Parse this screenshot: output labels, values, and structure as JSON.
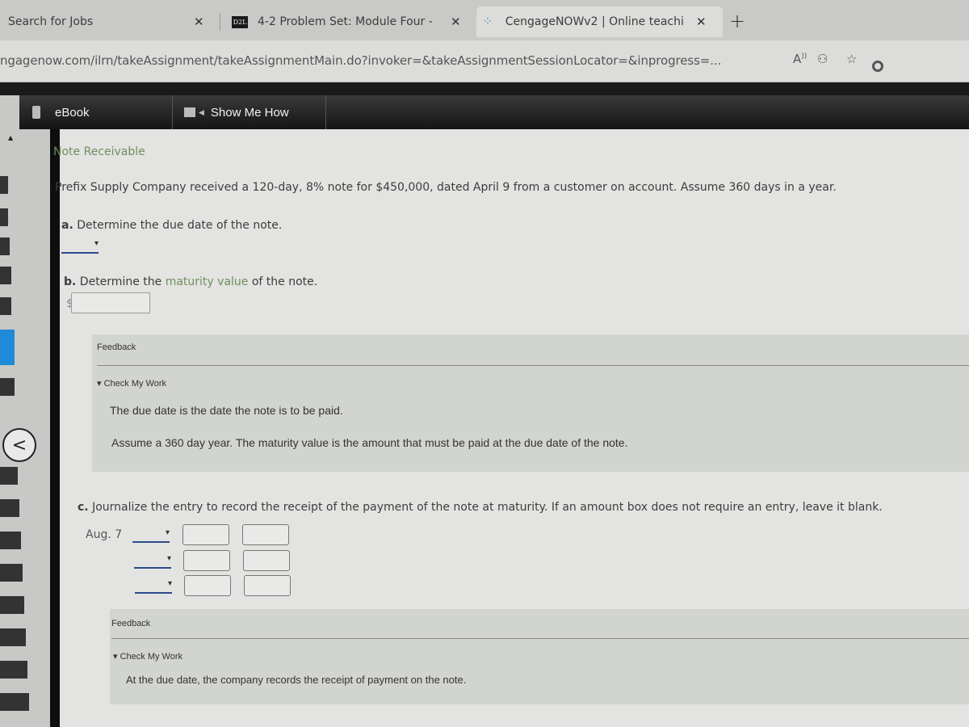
{
  "browser": {
    "tabs": [
      {
        "label": "Search for Jobs",
        "close": "✕"
      },
      {
        "label": "4-2 Problem Set: Module Four -",
        "favicon": "D2L",
        "close": "✕"
      },
      {
        "label": "CengageNOWv2 | Online teachi",
        "favicon": "loading-spinner",
        "close": "✕",
        "active": true
      }
    ],
    "new_tab": "+",
    "url": "ngagenow.com/ilrn/takeAssignment/takeAssignmentMain.do?invoker=&takeAssignmentSessionLocator=&inprogress=...",
    "icons": [
      "read-aloud-icon",
      "profile-icon",
      "add-favorite-icon",
      "extension-icon"
    ]
  },
  "toolbar": {
    "ebook_label": "eBook",
    "show_me_how_label": "Show Me How"
  },
  "problem": {
    "title": "Note Receivable",
    "statement": "Prefix Supply Company received a 120-day, 8% note for $450,000, dated April 9 from a customer on account. Assume 360 days in a year.",
    "part_a": {
      "prefix": "a.",
      "text": "Determine the due date of the note.",
      "due_date_value": ""
    },
    "part_b": {
      "prefix": "b.",
      "text_before": "Determine the",
      "link": "maturity value",
      "text_after": "of the note.",
      "currency": "$",
      "maturity_value": ""
    },
    "feedback_1": {
      "title": "Feedback",
      "check_label": "Check My Work",
      "lines": [
        "The due date is the date the note is to be paid.",
        "Assume a 360 day year. The maturity value is the amount that must be paid at the due date of the note."
      ]
    },
    "part_c": {
      "prefix": "c.",
      "text": "Journalize the entry to record the receipt of the payment of the note at maturity. If an amount box does not require an entry, leave it blank.",
      "date_label": "Aug. 7",
      "rows": [
        {
          "account": "",
          "debit": "",
          "credit": ""
        },
        {
          "account": "",
          "debit": "",
          "credit": ""
        },
        {
          "account": "",
          "debit": "",
          "credit": ""
        }
      ]
    },
    "feedback_2": {
      "title": "Feedback",
      "check_label": "Check My Work",
      "lines": [
        "At the due date, the company records the receipt of payment on the note."
      ]
    }
  },
  "colors": {
    "accent_green": "#6f8f5f",
    "dropdown_underline": "#2c4a8a",
    "toolbar_dark": "#1a1a1a"
  }
}
